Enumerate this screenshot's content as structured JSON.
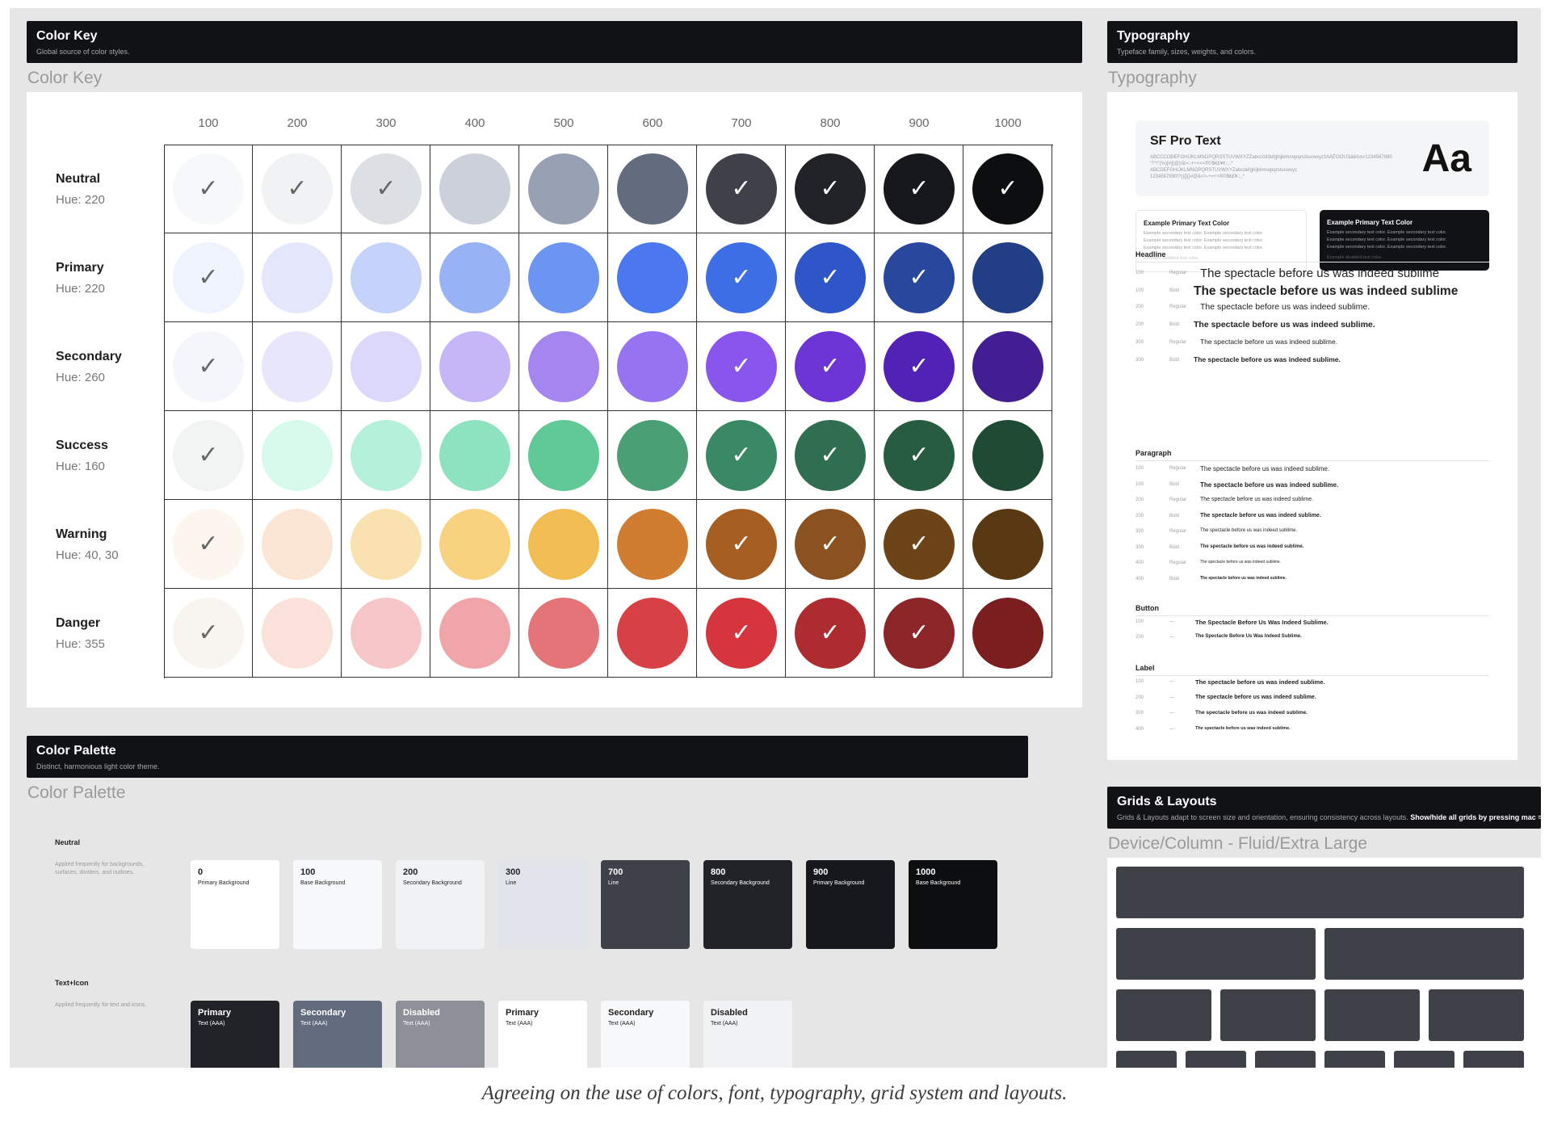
{
  "color_key": {
    "header_title": "Color Key",
    "header_subtitle": "Global source of color styles.",
    "section_title": "Color Key",
    "columns": [
      "100",
      "200",
      "300",
      "400",
      "500",
      "600",
      "700",
      "800",
      "900",
      "1000"
    ],
    "rows": [
      {
        "name": "Neutral",
        "hue": "Hue: 220",
        "colors": [
          "#f7f8f9",
          "#f1f2f4",
          "#dcdfe4",
          "#cbd0db",
          "#97a1b3",
          "#636b7e",
          "#3e414a",
          "#212329",
          "#16181d",
          "#0d0e10"
        ],
        "checked": [
          1,
          1,
          1,
          0,
          0,
          0,
          1,
          1,
          1,
          1
        ]
      },
      {
        "name": "Primary",
        "hue": "Hue: 220",
        "colors": [
          "#eef3fd",
          "#e4e6fc",
          "#c5d3fb",
          "#98b2f6",
          "#6b94f3",
          "#4b78ef",
          "#3e6ee6",
          "#2f56c8",
          "#2a479e",
          "#223f86"
        ],
        "checked": [
          1,
          0,
          0,
          0,
          0,
          0,
          1,
          1,
          1,
          0
        ]
      },
      {
        "name": "Secondary",
        "hue": "Hue: 260",
        "colors": [
          "#f5f6fb",
          "#e7e6fb",
          "#dcd8fb",
          "#c6b6f7",
          "#a585ef",
          "#9674f1",
          "#8a55ec",
          "#6e35d6",
          "#5221b5",
          "#431e92"
        ],
        "checked": [
          1,
          0,
          0,
          0,
          0,
          0,
          1,
          1,
          1,
          0
        ]
      },
      {
        "name": "Success",
        "hue": "Hue: 160",
        "colors": [
          "#f2f4f4",
          "#d7faec",
          "#b4f0da",
          "#8de2c0",
          "#60c996",
          "#4b9f75",
          "#3a8864",
          "#2f6e50",
          "#285c40",
          "#1f4a33"
        ],
        "checked": [
          1,
          0,
          0,
          0,
          0,
          0,
          1,
          1,
          1,
          0
        ]
      },
      {
        "name": "Warning",
        "hue": "Hue: 40, 30",
        "colors": [
          "#fdf6ee",
          "#fbe6d6",
          "#fae2b0",
          "#f8d27e",
          "#f1bd52",
          "#d07c31",
          "#a75e23",
          "#8b521f",
          "#6d4318",
          "#583914"
        ],
        "checked": [
          1,
          0,
          0,
          0,
          0,
          0,
          1,
          1,
          1,
          0
        ]
      },
      {
        "name": "Danger",
        "hue": "Hue: 355",
        "colors": [
          "#f8f4ef",
          "#fae1da",
          "#f6c6c9",
          "#f0a6a9",
          "#e47477",
          "#d74146",
          "#d6353d",
          "#ae2c30",
          "#8c2628",
          "#7a1e20"
        ],
        "checked": [
          1,
          0,
          0,
          0,
          0,
          0,
          1,
          1,
          1,
          0
        ]
      }
    ],
    "check_glyph": "✓"
  },
  "typography": {
    "header_title": "Typography",
    "header_subtitle": "Typeface family, sizes, weights, and colors.",
    "section_title": "Typography",
    "font_name": "SF Pro Text",
    "glyph_sample": "Aa",
    "charset_lines": [
      "ABCĆČDĐEFGHIJKLMNOPQRSŠTUVWXYZŽabcćčdđefghijklmnopqrsštuvwxyzžĂÂÊÔƠƯăâêôơư1234567890",
      "‘?’“!”(%)[#]{@}/&\\<-+÷×=>®©$€£¥¢:;,.*",
      "ABCDEFGHIJKLMNOPQRSTUVWXYZabcdefghijklmnopqrstuvwxyz",
      "1234567890!?()[]{}#@&<>-+=÷×®©$€£¥:;,.*"
    ],
    "light_card": {
      "title": "Example Primary Text Color",
      "lines": [
        "Example secondary text color. Example secondary text color.",
        "Example secondary text color. Example secondary text color.",
        "Example secondary text color. Example secondary text color."
      ],
      "disabled": "Example disabled text color."
    },
    "dark_card": {
      "title": "Example Primary Text Color",
      "lines": [
        "Example secondary text color. Example secondary text color.",
        "Example secondary text color. Example secondary text color.",
        "Example secondary text color. Example secondary text color."
      ],
      "disabled": "Example disabled text color."
    },
    "sample_text": "The spectacle before us was indeed sublime",
    "sample_text_period": "The spectacle before us was indeed sublime.",
    "sample_title_case": "The Spectacle Before Us Was Indeed Sublime.",
    "headline_label": "Headline",
    "paragraph_label": "Paragraph",
    "button_label": "Button",
    "label_label": "Label",
    "headline_rows": [
      {
        "size": "100",
        "weight": "Regular"
      },
      {
        "size": "100",
        "weight": "Bold"
      },
      {
        "size": "200",
        "weight": "Regular"
      },
      {
        "size": "200",
        "weight": "Bold"
      },
      {
        "size": "300",
        "weight": "Regular"
      },
      {
        "size": "300",
        "weight": "Bold"
      }
    ],
    "paragraph_rows": [
      {
        "size": "100",
        "weight": "Regular"
      },
      {
        "size": "100",
        "weight": "Bold"
      },
      {
        "size": "200",
        "weight": "Regular"
      },
      {
        "size": "200",
        "weight": "Bold"
      },
      {
        "size": "300",
        "weight": "Regular"
      },
      {
        "size": "300",
        "weight": "Bold"
      },
      {
        "size": "400",
        "weight": "Regular"
      },
      {
        "size": "400",
        "weight": "Bold"
      }
    ],
    "button_rows": [
      {
        "size": "100",
        "weight": "—"
      },
      {
        "size": "200",
        "weight": "—"
      }
    ],
    "label_rows": [
      {
        "size": "100",
        "weight": "—"
      },
      {
        "size": "200",
        "weight": "—"
      },
      {
        "size": "300",
        "weight": "—"
      },
      {
        "size": "400",
        "weight": "—"
      }
    ]
  },
  "palette": {
    "header_title": "Color Palette",
    "header_subtitle": "Distinct, harmonious light color theme.",
    "section_title": "Color Palette",
    "neutral": {
      "title": "Neutral",
      "desc": "Applied frequently for backgrounds, surfaces, dividers, and outlines.",
      "tiles": [
        {
          "num": "0",
          "label": "Primary Background",
          "bg": "#ffffff",
          "fg": "#222222"
        },
        {
          "num": "100",
          "label": "Base Background",
          "bg": "#f7f8f9",
          "fg": "#222222"
        },
        {
          "num": "200",
          "label": "Secondary Background",
          "bg": "#f1f2f4",
          "fg": "#222222"
        },
        {
          "num": "300",
          "label": "Line",
          "bg": "#e1e4ea",
          "fg": "#222222"
        },
        {
          "num": "700",
          "label": "Line",
          "bg": "#3e414a",
          "fg": "#ffffff"
        },
        {
          "num": "800",
          "label": "Secondary Background",
          "bg": "#212329",
          "fg": "#ffffff"
        },
        {
          "num": "900",
          "label": "Primary Background",
          "bg": "#16181d",
          "fg": "#ffffff"
        },
        {
          "num": "1000",
          "label": "Base Background",
          "bg": "#0d0e10",
          "fg": "#ffffff"
        }
      ]
    },
    "text_icon": {
      "title": "Text+Icon",
      "desc": "Applied frequently for text and icons.",
      "tiles": [
        {
          "num": "Primary",
          "label": "Text (AAA)",
          "bg": "#212329",
          "fg": "#ffffff"
        },
        {
          "num": "Secondary",
          "label": "Text (AAA)",
          "bg": "#636b7e",
          "fg": "#ffffff"
        },
        {
          "num": "Disabled",
          "label": "Text (AAA)",
          "bg": "#8d9098",
          "fg": "#ffffff"
        },
        {
          "num": "Primary",
          "label": "Text (AAA)",
          "bg": "#ffffff",
          "fg": "#222222"
        },
        {
          "num": "Secondary",
          "label": "Text (AAA)",
          "bg": "#f7f8f9",
          "fg": "#222222"
        },
        {
          "num": "Disabled",
          "label": "Text (AAA)",
          "bg": "#f1f2f4",
          "fg": "#222222"
        }
      ]
    }
  },
  "grids": {
    "header_title": "Grids & Layouts",
    "header_subtitle": "Grids & Layouts adapt to screen size and orientation, ensuring consistency across layouts.",
    "header_subtitle_bold": "Show/hide all grids by pressing mac = control +",
    "section_title": "Device/Column - Fluid/Extra Large"
  },
  "caption": "Agreeing on the use of colors, font, typography, grid system and layouts."
}
